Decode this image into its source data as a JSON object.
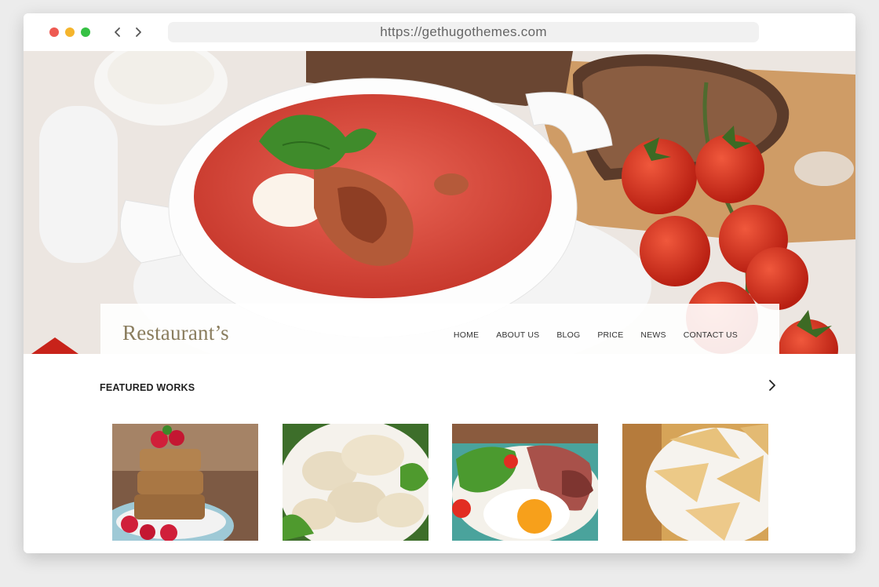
{
  "browser": {
    "url": "https://gethugothemes.com"
  },
  "site": {
    "brand": "Restaurant’s",
    "menu": [
      "HOME",
      "ABOUT US",
      "BLOG",
      "PRICE",
      "NEWS",
      "CONTACT US"
    ]
  },
  "featured": {
    "title": "FEATURED WORKS",
    "items": [
      {
        "image": "cake-with-raspberries"
      },
      {
        "image": "dumplings"
      },
      {
        "image": "steak-egg-salad"
      },
      {
        "image": "crepes"
      }
    ]
  },
  "colors": {
    "brand": "#8a7d5e",
    "soup": "#d9473a",
    "tomato": "#d8311e"
  }
}
